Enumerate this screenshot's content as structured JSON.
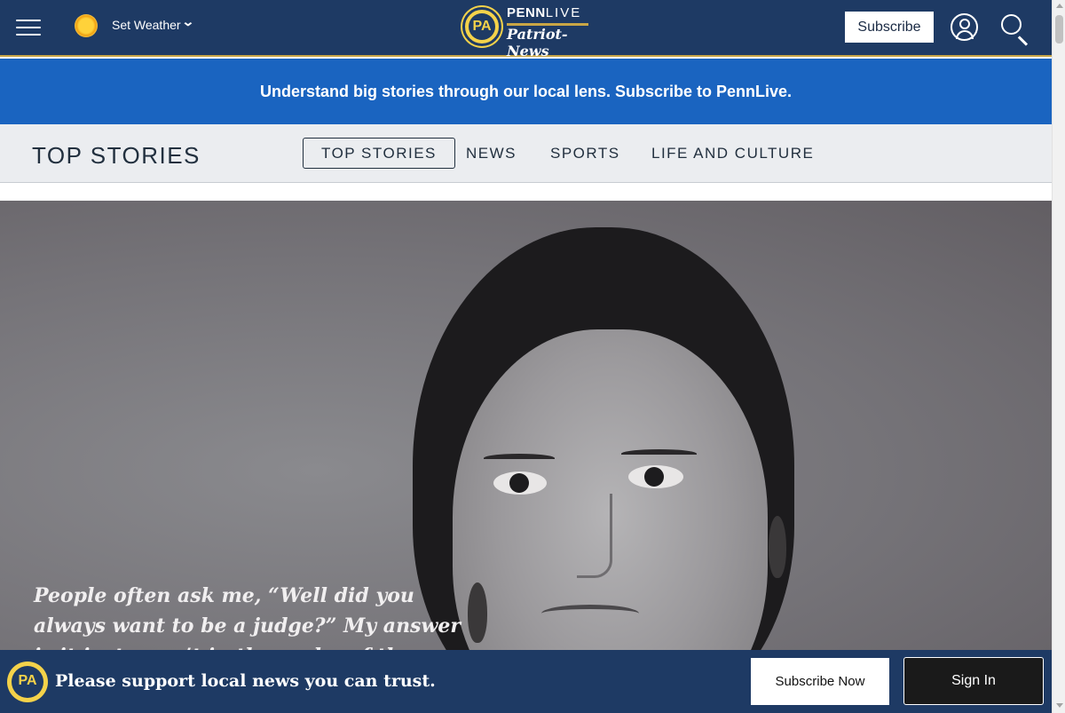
{
  "header": {
    "weather_label": "Set Weather",
    "weather_chevron": "⌄",
    "logo": {
      "badge": "PA",
      "line1_bold": "PENN",
      "line1_light": "LIVE",
      "line2": "Patriot-News"
    },
    "subscribe_label": "Subscribe"
  },
  "promo": {
    "text": "Understand big stories through our local lens. Subscribe to PennLive."
  },
  "section_nav": {
    "title": "TOP STORIES",
    "tabs": [
      {
        "label": "TOP STORIES",
        "active": true
      },
      {
        "label": "NEWS",
        "active": false
      },
      {
        "label": "SPORTS",
        "active": false
      },
      {
        "label": "LIFE AND CULTURE",
        "active": false
      }
    ]
  },
  "hero": {
    "quote": "People often ask me, “Well did you always want to be a judge?” My answer is it just wasn’t in the realm of the possible until"
  },
  "bottom_bar": {
    "badge": "PA",
    "text": "Please support local news you can trust.",
    "subscribe_now_label": "Subscribe Now",
    "sign_in_label": "Sign In"
  },
  "colors": {
    "header_bg": "#1e3a64",
    "promo_bg": "#1a64c0",
    "nav_bg": "#ebedf0",
    "accent_gold": "#c9a646"
  },
  "icons": {
    "menu": "hamburger-menu-icon",
    "weather": "sun-icon",
    "user": "user-icon",
    "search": "search-icon"
  }
}
